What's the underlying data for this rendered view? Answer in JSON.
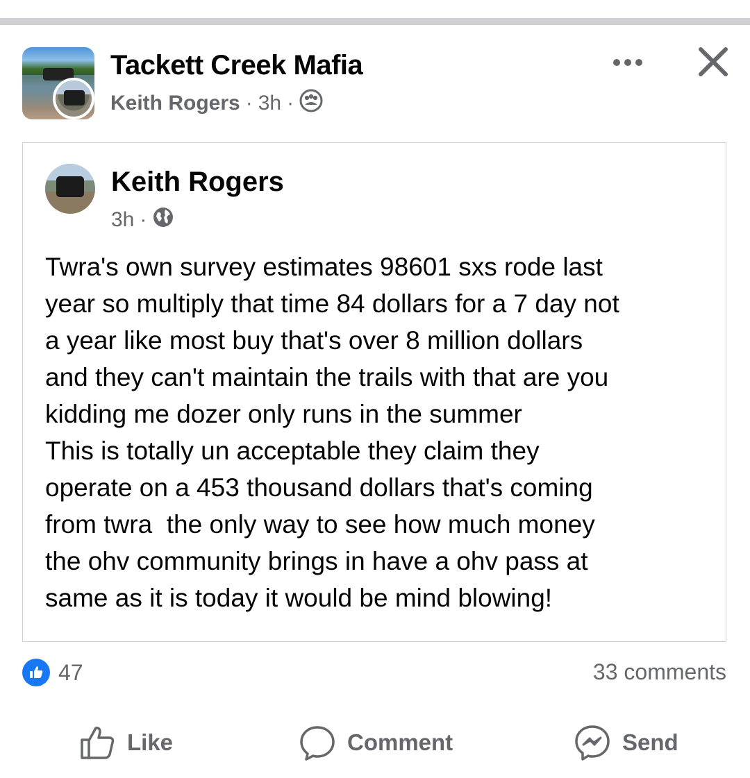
{
  "header": {
    "group_name": "Tackett Creek Mafia",
    "author": "Keith Rogers",
    "separator": "·",
    "time": "3h",
    "audience_icon": "group-members-icon",
    "more_icon": "more-options-icon",
    "close_icon": "close-icon"
  },
  "shared_post": {
    "author": "Keith Rogers",
    "time": "3h",
    "separator": "·",
    "audience_icon": "globe-icon",
    "body_lines": [
      "Twra's own survey estimates 98601 sxs rode last",
      "year so multiply that time 84 dollars for a 7 day not",
      "a year like most buy that's over 8 million dollars",
      "and they can't maintain the trails with that are you",
      "kidding me dozer only runs in the summer",
      "This is totally un acceptable they claim they",
      "operate on a 453 thousand dollars that's coming",
      "from twra  the only way to see how much money",
      "the ohv community brings in have a ohv pass at",
      "same as it is today it would be mind blowing!"
    ]
  },
  "engagement": {
    "likes": "47",
    "comments": "33 comments",
    "reaction_icon": "thumbs-up-reaction-icon",
    "accent_color": "#1877f2"
  },
  "actions": {
    "like_label": "Like",
    "comment_label": "Comment",
    "send_label": "Send"
  }
}
